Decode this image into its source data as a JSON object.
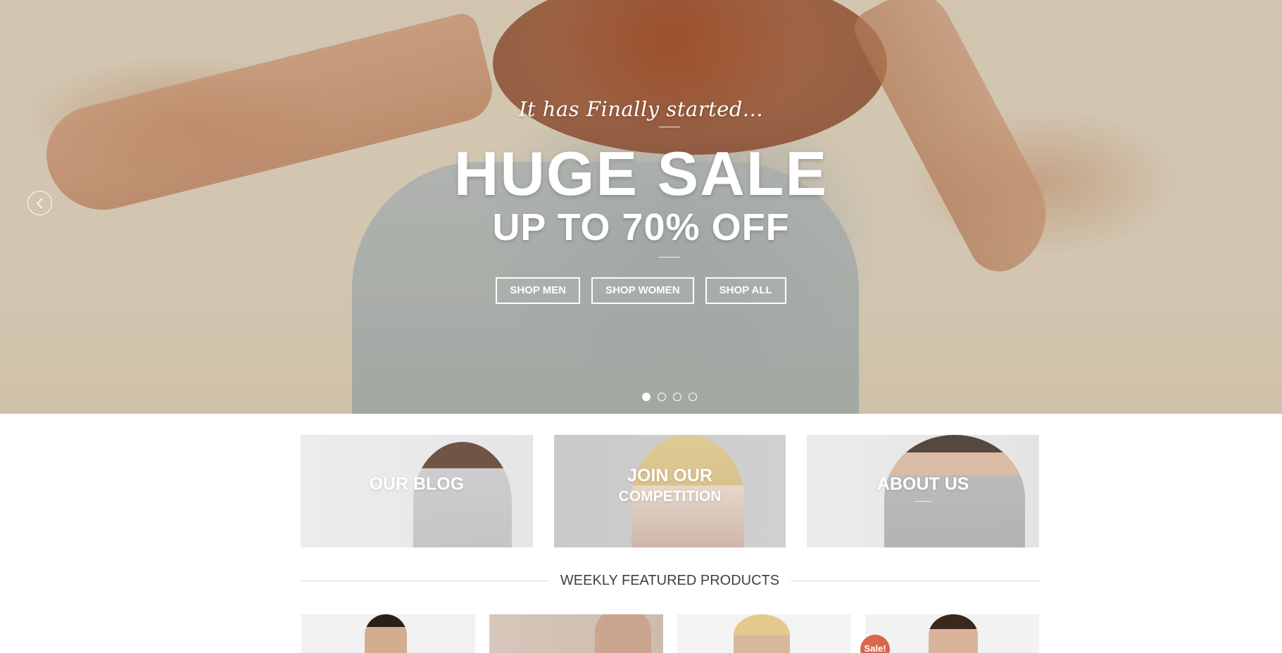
{
  "hero": {
    "tagline": "It has Finally started...",
    "title": "HUGE SALE",
    "subtitle": "UP TO 70% OFF",
    "buttons": [
      {
        "label": "SHOP MEN"
      },
      {
        "label": "SHOP WOMEN"
      },
      {
        "label": "SHOP ALL"
      }
    ],
    "prev_icon": "chevron-left-icon",
    "slides_count": 4,
    "active_slide": 1
  },
  "banners": {
    "blog": {
      "label": "OUR BLOG"
    },
    "competition": {
      "line1": "JOIN OUR",
      "line2": "COMPETITION"
    },
    "about": {
      "label": "ABOUT US"
    }
  },
  "featured": {
    "title": "WEEKLY FEATURED PRODUCTS"
  },
  "products": {
    "sale_badge": "Sale!"
  },
  "colors": {
    "sale_badge": "#d8684b",
    "heading_text": "#3f3f3f",
    "divider": "#dcdcdc"
  }
}
